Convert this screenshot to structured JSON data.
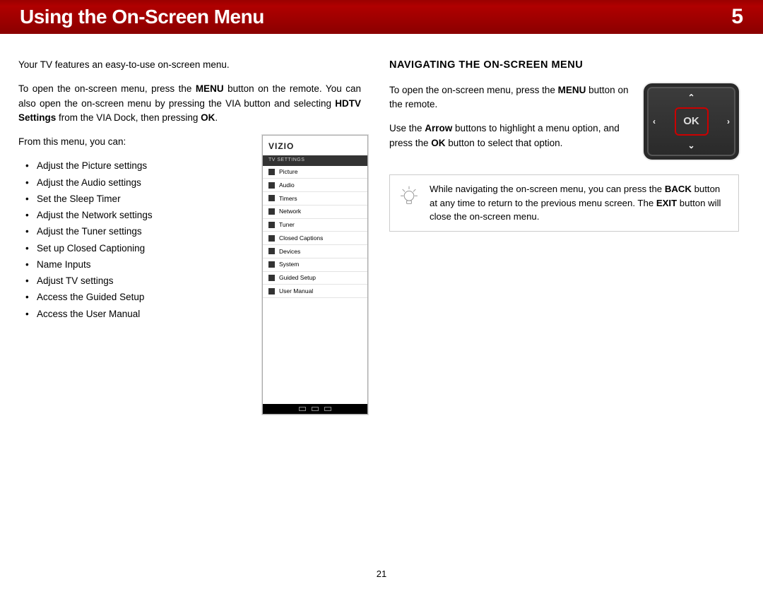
{
  "banner": {
    "title": "Using the On-Screen Menu",
    "chapter": "5"
  },
  "left": {
    "intro": "Your TV features an easy-to-use on-screen menu.",
    "open_1a": "To open the on-screen menu, press the ",
    "open_menu": "MENU",
    "open_1b": " button on the remote. You can also open the on-screen menu by pressing the VIA button and selecting ",
    "open_hdtv": "HDTV Settings",
    "open_1c": " from the VIA Dock, then pressing ",
    "open_ok": "OK",
    "open_1d": ".",
    "from": "From this menu, you can:",
    "bullets": [
      "Adjust the Picture settings",
      "Adjust the Audio settings",
      "Set the Sleep Timer",
      "Adjust the Network settings",
      "Adjust the Tuner settings",
      "Set up Closed Captioning",
      "Name Inputs",
      "Adjust TV settings",
      "Access the Guided Setup",
      "Access the User Manual"
    ]
  },
  "tvmenu": {
    "brand": "VIZIO",
    "header": "TV SETTINGS",
    "items": [
      "Picture",
      "Audio",
      "Timers",
      "Network",
      "Tuner",
      "Closed Captions",
      "Devices",
      "System",
      "Guided Setup",
      "User Manual"
    ]
  },
  "right": {
    "heading": "NAVIGATING THE ON-SCREEN MENU",
    "p1a": "To open the on-screen menu, press the ",
    "p1b": "MENU",
    "p1c": " button on the remote.",
    "p2a": "Use the ",
    "p2b": "Arrow",
    "p2c": " buttons to highlight a menu option, and press the ",
    "p2d": "OK",
    "p2e": " button to select that option.",
    "ok_label": "OK"
  },
  "tip": {
    "t1": "While navigating the on-screen menu, you can press the ",
    "t2": "BACK",
    "t3": " button at any time to return to the previous menu screen. The ",
    "t4": "EXIT",
    "t5": " button will close the on-screen menu."
  },
  "page_number": "21"
}
